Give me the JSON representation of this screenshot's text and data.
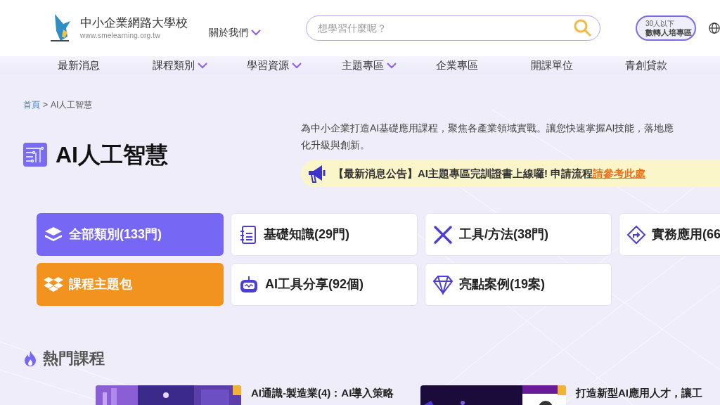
{
  "header": {
    "logo_title": "中小企業網路大學校",
    "logo_url": "www.smelearning.org.tw",
    "about": "關於我們",
    "search": {
      "placeholder": "想學習什麼呢？"
    },
    "promo": {
      "small": "30人以下",
      "label": "數轉人培專區"
    }
  },
  "nav": [
    {
      "label": "最新消息",
      "dropdown": false
    },
    {
      "label": "課程類別",
      "dropdown": true
    },
    {
      "label": "學習資源",
      "dropdown": true
    },
    {
      "label": "主題專區",
      "dropdown": true
    },
    {
      "label": "企業專區",
      "dropdown": false
    },
    {
      "label": "開課單位",
      "dropdown": false
    },
    {
      "label": "青創貸款",
      "dropdown": false
    }
  ],
  "breadcrumb": [
    {
      "label": "首頁",
      "link": true
    },
    {
      "label": ">",
      "link": false
    },
    {
      "label": "AI人工智慧",
      "link": false
    }
  ],
  "page_title": "AI人工智慧",
  "description": [
    "為中小企業打造AI基礎應用課程，聚焦各產業領域實戰。讓您快速掌握AI技能，落地應",
    "化升級與創新。"
  ],
  "announcement": {
    "text": "【最新消息公告】AI主題專區完訓證書上線囉! 申請流程",
    "link": "請參考此處"
  },
  "categories": [
    {
      "label": "全部類別(133門)",
      "kind": "all",
      "selected": true
    },
    {
      "label": "基礎知識(29門)",
      "kind": "book",
      "selected": false
    },
    {
      "label": "工具/方法(38門)",
      "kind": "tools",
      "selected": false
    },
    {
      "label": "實務應用(66",
      "kind": "route",
      "selected": false
    },
    {
      "label": "課程主題包",
      "kind": "package",
      "selected": false
    },
    {
      "label": "AI工具分享(92個)",
      "kind": "robot",
      "selected": false
    },
    {
      "label": "亮點案例(19案)",
      "kind": "gem",
      "selected": false
    }
  ],
  "hot_courses": {
    "title": "熱門課程",
    "items": [
      {
        "title": "AI通識-製造業(4)：AI導入策略"
      },
      {
        "title": "打造新型AI應用人才，讓工"
      }
    ]
  }
}
